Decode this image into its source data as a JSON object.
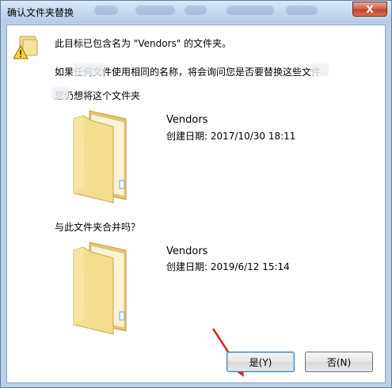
{
  "window": {
    "title": "确认文件夹替换",
    "close_label": "X"
  },
  "message": {
    "line1": "此目标已包含名为 \"Vendors\" 的文件夹。",
    "line2": "如果任何文件使用相同的名称，将会询问您是否要替换这些文件",
    "line3": "您仍想将这个文件夹",
    "merge_question": "与此文件夹合并吗？"
  },
  "existing_folder": {
    "name": "Vendors",
    "created": "创建日期: 2017/10/30 18:11"
  },
  "new_folder": {
    "name": "Vendors",
    "created": "创建日期: 2019/6/12 15:14"
  },
  "buttons": {
    "yes": "是(Y)",
    "no": "否(N)"
  },
  "colors": {
    "annotation_arrow": "#e01818",
    "folder_fill": "#f3dd8f",
    "folder_edge": "#c9a84a"
  }
}
